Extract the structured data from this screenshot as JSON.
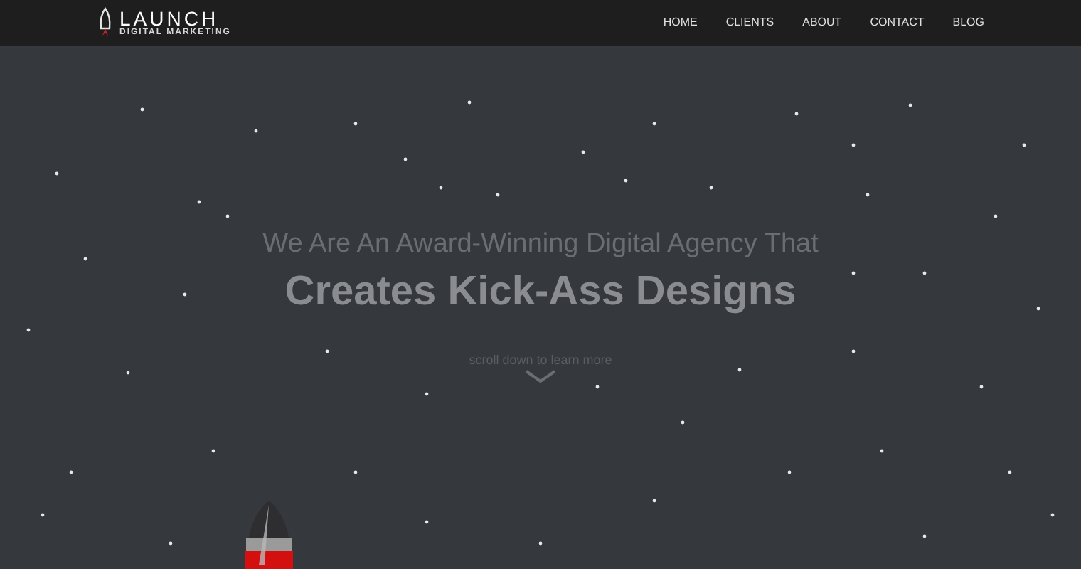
{
  "logo": {
    "name": "LAUNCH",
    "tagline": "DIGITAL MARKETING"
  },
  "nav": [
    {
      "label": "HOME"
    },
    {
      "label": "CLIENTS"
    },
    {
      "label": "ABOUT"
    },
    {
      "label": "CONTACT"
    },
    {
      "label": "BLOG"
    }
  ],
  "hero": {
    "subtitle": "We Are An Award-Winning Digital Agency That",
    "title": "Creates Kick-Ass Designs",
    "scroll_hint": "scroll down to learn more"
  }
}
